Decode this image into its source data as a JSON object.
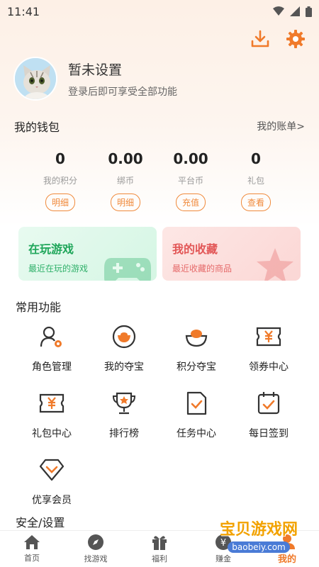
{
  "status": {
    "time": "11:41"
  },
  "profile": {
    "name": "暂未设置",
    "subtitle": "登录后即可享受全部功能"
  },
  "wallet": {
    "title": "我的钱包",
    "bill_link": "我的账单>",
    "items": [
      {
        "value": "0",
        "label": "我的积分",
        "button": "明细"
      },
      {
        "value": "0.00",
        "label": "绑币",
        "button": "明细"
      },
      {
        "value": "0.00",
        "label": "平台币",
        "button": "充值"
      },
      {
        "value": "0",
        "label": "礼包",
        "button": "查看"
      }
    ]
  },
  "cards": [
    {
      "title": "在玩游戏",
      "subtitle": "最近在玩的游戏"
    },
    {
      "title": "我的收藏",
      "subtitle": "最近收藏的商品"
    }
  ],
  "common": {
    "title": "常用功能",
    "items": [
      {
        "label": "角色管理",
        "icon": "role-icon"
      },
      {
        "label": "我的夺宝",
        "icon": "treasure-icon"
      },
      {
        "label": "积分夺宝",
        "icon": "points-treasure-icon"
      },
      {
        "label": "领券中心",
        "icon": "coupon-icon"
      },
      {
        "label": "礼包中心",
        "icon": "gift-ticket-icon"
      },
      {
        "label": "排行榜",
        "icon": "trophy-icon"
      },
      {
        "label": "任务中心",
        "icon": "task-icon"
      },
      {
        "label": "每日签到",
        "icon": "calendar-check-icon"
      },
      {
        "label": "优享会员",
        "icon": "diamond-icon"
      }
    ]
  },
  "security": {
    "title": "安全/设置"
  },
  "tabs": [
    {
      "label": "首页",
      "icon": "home-icon"
    },
    {
      "label": "找游戏",
      "icon": "compass-icon"
    },
    {
      "label": "福利",
      "icon": "gift-icon"
    },
    {
      "label": "赚金",
      "icon": "coin-icon"
    },
    {
      "label": "我的",
      "icon": "user-icon",
      "active": true
    }
  ],
  "watermark": {
    "line1": "宝贝游戏网",
    "line2": "baobeiy.com"
  },
  "colors": {
    "accent": "#f07a2a",
    "green": "#1fa65a",
    "red": "#e25757"
  }
}
